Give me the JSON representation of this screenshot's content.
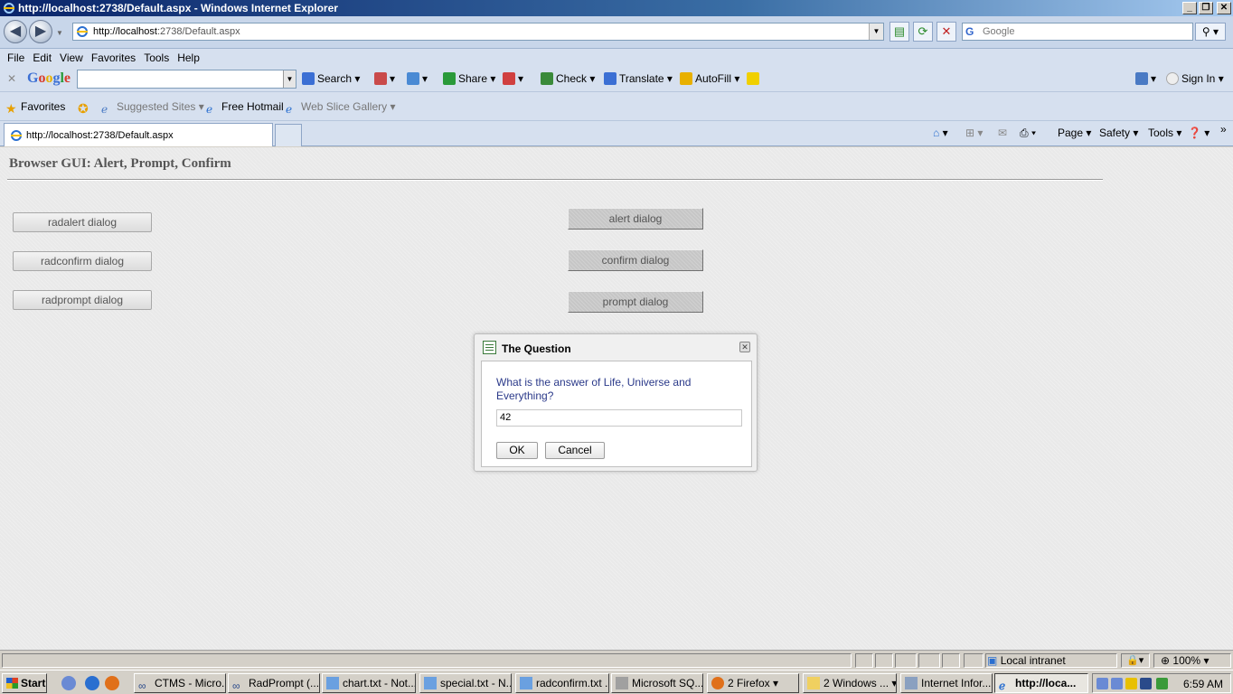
{
  "window": {
    "title": "http://localhost:2738/Default.aspx - Windows Internet Explorer"
  },
  "address": {
    "url_host": "http://localhost",
    "url_rest": ":2738/Default.aspx"
  },
  "search": {
    "placeholder": "Google"
  },
  "menu": [
    "File",
    "Edit",
    "View",
    "Favorites",
    "Tools",
    "Help"
  ],
  "google_toolbar": {
    "logo": "Google",
    "search_label": "Search",
    "share_label": "Share",
    "check_label": "Check",
    "translate_label": "Translate",
    "autofill_label": "AutoFill",
    "signin_label": "Sign In"
  },
  "favorites_bar": {
    "favorites_label": "Favorites",
    "suggested_sites": "Suggested Sites",
    "free_hotmail": "Free Hotmail",
    "web_slice_gallery": "Web Slice Gallery"
  },
  "tab": {
    "title": "http://localhost:2738/Default.aspx"
  },
  "command_bar": {
    "page": "Page",
    "safety": "Safety",
    "tools": "Tools"
  },
  "page": {
    "title": "Browser GUI: Alert, Prompt, Confirm",
    "rad_buttons": [
      "radalert dialog",
      "radconfirm dialog",
      "radprompt dialog"
    ],
    "std_buttons": [
      "alert dialog",
      "confirm dialog",
      "prompt dialog"
    ]
  },
  "dialog": {
    "title": "The Question",
    "message": "What is the answer of Life, Universe and Everything?",
    "input_value": "42",
    "ok_label": "OK",
    "cancel_label": "Cancel"
  },
  "status_bar": {
    "zone": "Local intranet",
    "zoom": "100%"
  },
  "taskbar": {
    "start_label": "Start",
    "items": [
      "CTMS - Micro...",
      "RadPrompt (...",
      "chart.txt - Not...",
      "special.txt - N...",
      "radconfirm.txt ...",
      "Microsoft SQ...",
      "2 Firefox",
      "2 Windows ...",
      "Internet Infor...",
      "http://loca..."
    ],
    "clock": "6:59 AM"
  },
  "colors": {
    "accent": "#0a246a",
    "dialog_text": "#2b3a8a"
  }
}
